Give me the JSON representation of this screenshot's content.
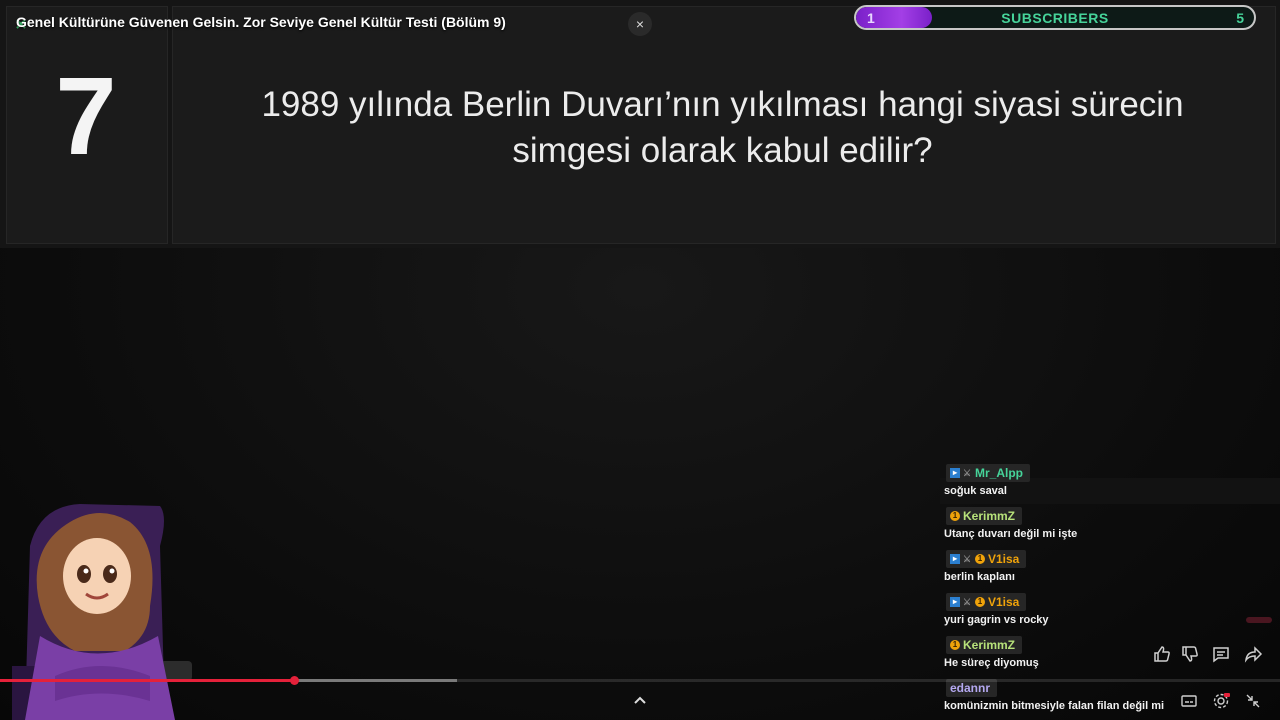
{
  "video": {
    "title": "Genel Kültürüne Güvenen Gelsin. Zor Seviye Genel Kültür Testi (Bölüm 9)",
    "close_label": "×",
    "progress_played_fraction": 0.23,
    "progress_buffered_fraction": 0.357
  },
  "question": {
    "number": "7",
    "text": "1989 yılında Berlin Duvarı’nın yıkılması hangi siyasi sürecin simgesi olarak kabul edilir?"
  },
  "subscribers": {
    "current": "1",
    "label": "SUBSCRIBERS",
    "goal": "5",
    "fill_fraction": 0.19,
    "fill_color": "#9b35e0",
    "text_color": "#46d49a"
  },
  "chat": {
    "messages": [
      {
        "user": "Mr_Alpp",
        "color": "#46d49a",
        "badges": [
          "prime-icon",
          "sword-icon"
        ],
        "text": "soğuk saval"
      },
      {
        "user": "KerimmZ",
        "color": "#b7e27a",
        "badges": [
          "coin-icon"
        ],
        "text": "Utanç duvarı değil mi işte"
      },
      {
        "user": "V1isa",
        "color": "#f0a30a",
        "badges": [
          "prime-icon",
          "sword-icon",
          "coin-icon"
        ],
        "text": "berlin kaplanı"
      },
      {
        "user": "V1isa",
        "color": "#f0a30a",
        "badges": [
          "prime-icon",
          "sword-icon",
          "coin-icon"
        ],
        "text": "yuri gagrin vs rocky"
      },
      {
        "user": "KerimmZ",
        "color": "#b7e27a",
        "badges": [
          "coin-icon"
        ],
        "text": "He süreç diyomuş"
      },
      {
        "user": "edannr",
        "color": "#b4a8f0",
        "badges": [],
        "text": "komünizmin bitmesiyle falan filan değil mi"
      }
    ]
  },
  "controls": {
    "icons": [
      "like-icon",
      "dislike-icon",
      "comment-icon",
      "share-icon",
      "captions-icon",
      "settings-icon",
      "exit-fullscreen-icon",
      "chevron-up-icon"
    ],
    "accent": "#e5213a"
  }
}
